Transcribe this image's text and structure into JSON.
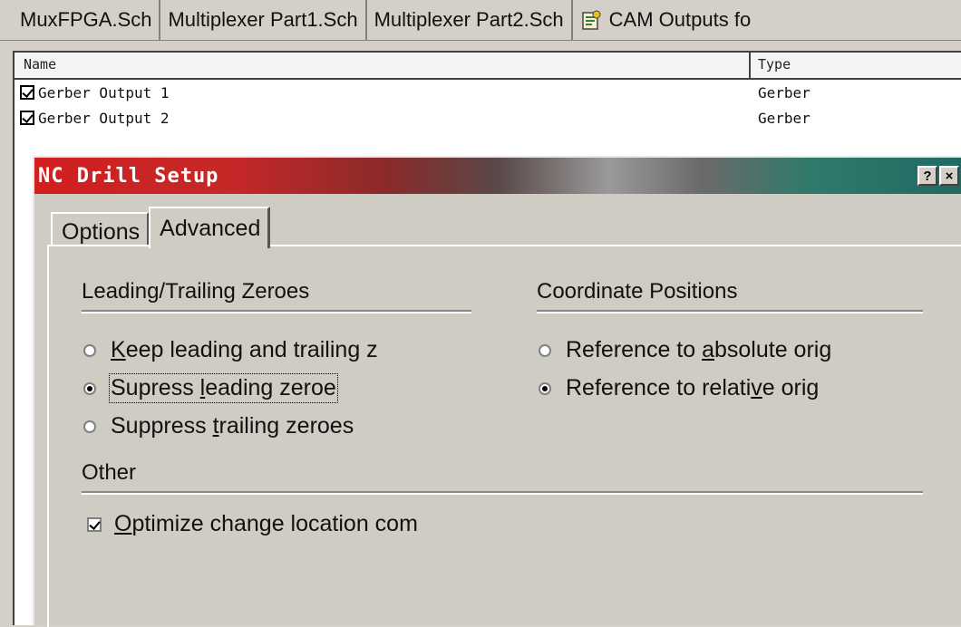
{
  "doc_tabs": [
    {
      "label": "MuxFPGA.Sch"
    },
    {
      "label": "Multiplexer Part1.Sch"
    },
    {
      "label": "Multiplexer Part2.Sch"
    },
    {
      "label": "CAM Outputs fo",
      "icon": "cam-document-icon",
      "active": true
    }
  ],
  "output_list": {
    "columns": {
      "name": "Name",
      "type": "Type"
    },
    "rows": [
      {
        "name": "Gerber Output 1",
        "type": "Gerber",
        "enabled": true
      },
      {
        "name": "Gerber Output 2",
        "type": "Gerber",
        "enabled": true
      }
    ]
  },
  "dialog": {
    "title": "NC Drill Setup",
    "help_label": "?",
    "close_label": "×",
    "tabs": [
      {
        "label": "Options",
        "active": false
      },
      {
        "label": "Advanced",
        "active": true
      }
    ],
    "zeroes": {
      "title": "Leading/Trailing Zeroes",
      "options": [
        {
          "pre": "",
          "key": "K",
          "post": "eep leading and trailing z",
          "selected": false
        },
        {
          "pre": "Supress ",
          "key": "l",
          "post": "eading zeroe",
          "selected": true
        },
        {
          "pre": "Suppress ",
          "key": "t",
          "post": "railing zeroes",
          "selected": false
        }
      ]
    },
    "coords": {
      "title": "Coordinate Positions",
      "options": [
        {
          "pre": "Reference to ",
          "key": "a",
          "post": "bsolute orig",
          "selected": false
        },
        {
          "pre": "Reference to relati",
          "key": "v",
          "post": "e orig",
          "selected": true
        }
      ]
    },
    "other": {
      "title": "Other",
      "optimize": {
        "pre": "",
        "key": "O",
        "post": "ptimize change location com",
        "checked": true
      }
    }
  },
  "colors": {
    "title_start": "#d21f1f",
    "title_end": "#206a62",
    "face": "#cfccc4"
  }
}
